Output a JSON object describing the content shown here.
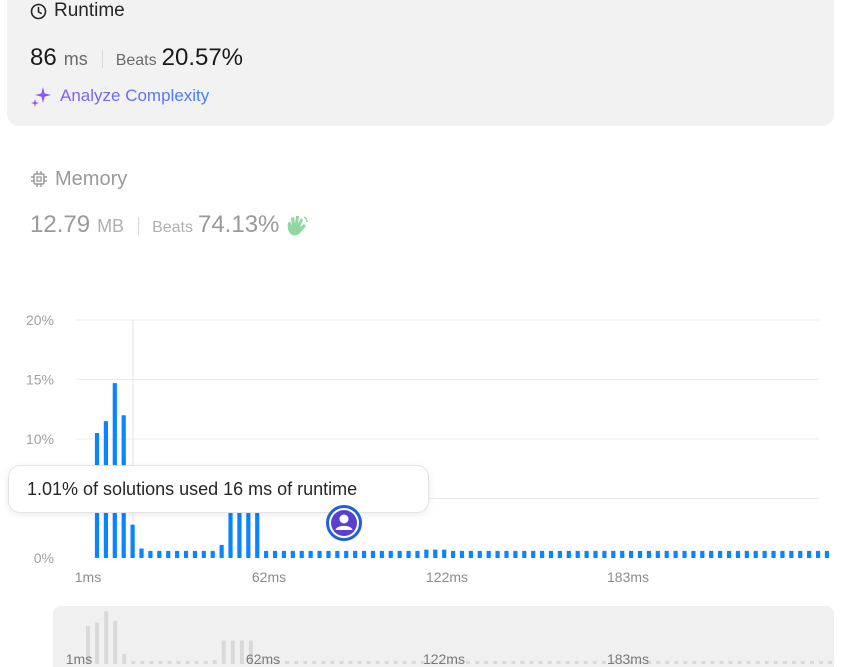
{
  "runtime": {
    "title": "Runtime",
    "value": "86",
    "unit": "ms",
    "beats_label": "Beats",
    "beats_value": "20.57%",
    "analyze_label": "Analyze Complexity"
  },
  "memory": {
    "title": "Memory",
    "value": "12.79",
    "unit": "MB",
    "beats_label": "Beats",
    "beats_value": "74.13%"
  },
  "tooltip": {
    "text": "1.01% of solutions used 16 ms of runtime"
  },
  "colors": {
    "bar": "#0a84ff",
    "nav_bar": "#d9d9d9",
    "accent_start": "#8a5cf6",
    "accent_end": "#3b82f6",
    "avatar": "#5b3fd1"
  },
  "chart_data": {
    "type": "bar",
    "ylabel": "",
    "xlabel": "",
    "ylim": [
      0,
      20
    ],
    "y_ticks": [
      "0%",
      "5%",
      "10%",
      "15%",
      "20%"
    ],
    "x_ticks": [
      "1ms",
      "62ms",
      "122ms",
      "183ms"
    ],
    "x_tick_values": [
      1,
      62,
      122,
      183
    ],
    "series": [
      {
        "x": [
          4,
          7,
          10,
          13,
          16,
          19,
          22,
          25,
          28,
          31,
          34,
          37,
          40,
          43,
          46,
          49,
          52,
          55,
          58,
          61,
          64,
          67,
          70,
          73,
          76,
          79,
          82,
          85,
          88,
          91,
          94,
          97,
          100,
          103,
          106,
          109,
          112,
          115,
          118,
          121,
          124,
          127,
          130,
          133,
          136,
          139,
          142,
          145,
          148,
          151,
          154,
          157,
          160,
          163,
          166,
          169,
          172,
          175,
          178,
          181,
          184,
          187,
          190,
          193,
          196,
          199,
          202,
          205,
          208,
          211,
          214,
          217,
          220,
          223,
          226,
          229,
          232,
          235,
          238,
          241,
          244,
          247,
          250
        ],
        "values": [
          10.5,
          11.5,
          14.7,
          12.0,
          2.8,
          0.8,
          0.6,
          0.6,
          0.6,
          0.6,
          0.6,
          0.6,
          0.6,
          0.6,
          1.1,
          6.5,
          6.5,
          6.5,
          6.5,
          0.6,
          0.6,
          0.6,
          0.6,
          0.6,
          0.6,
          0.6,
          0.6,
          0.6,
          0.6,
          0.6,
          0.6,
          0.6,
          0.6,
          0.6,
          0.6,
          0.6,
          0.6,
          0.7,
          0.7,
          0.7,
          0.6,
          0.6,
          0.6,
          0.6,
          0.6,
          0.6,
          0.6,
          0.6,
          0.6,
          0.6,
          0.6,
          0.6,
          0.6,
          0.6,
          0.6,
          0.6,
          0.6,
          0.6,
          0.6,
          0.6,
          0.6,
          0.6,
          0.6,
          0.6,
          0.6,
          0.6,
          0.6,
          0.6,
          0.6,
          0.6,
          0.6,
          0.6,
          0.6,
          0.6,
          0.6,
          0.6,
          0.6,
          0.6,
          0.6,
          0.6,
          0.6,
          0.6,
          0.6
        ]
      }
    ],
    "grid": true
  }
}
